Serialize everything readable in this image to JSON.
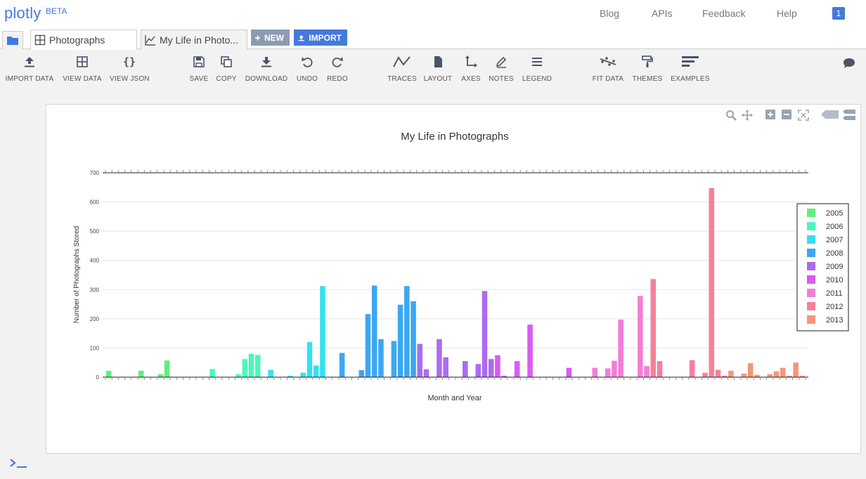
{
  "app": {
    "logo": "plotly",
    "beta": "BETA"
  },
  "topnav": {
    "blog": "Blog",
    "apis": "APIs",
    "feedback": "Feedback",
    "help": "Help",
    "notifications": "1"
  },
  "tabs": {
    "folder_icon": "folder-icon",
    "items": [
      {
        "label": "Photographs",
        "icon": "grid-icon"
      },
      {
        "label": "My Life in Photo...",
        "icon": "line-chart-icon"
      }
    ],
    "new_label": "NEW",
    "import_label": "IMPORT"
  },
  "toolbar": {
    "import_data": "IMPORT DATA",
    "view_data": "VIEW DATA",
    "view_json": "VIEW JSON",
    "save": "SAVE",
    "copy": "COPY",
    "download": "DOWNLOAD",
    "undo": "UNDO",
    "redo": "REDO",
    "traces": "TRACES",
    "layout": "LAYOUT",
    "axes": "AXES",
    "notes": "NOTES",
    "legend": "LEGEND",
    "fit_data": "FIT DATA",
    "themes": "THEMES",
    "examples": "EXAMPLES"
  },
  "colors": {
    "accent": "#447adb",
    "new_button": "#8c9bb3",
    "icon": "#4a5568"
  },
  "chart_data": {
    "type": "bar",
    "title": "My Life in Photographs",
    "xlabel": "Month and Year",
    "ylabel": "Number of Photographs Stored",
    "ylim": [
      0,
      700
    ],
    "yticks": [
      0,
      100,
      200,
      300,
      400,
      500,
      600,
      700
    ],
    "grid": true,
    "legend_position": "right",
    "slots_per_year": 12,
    "series": [
      {
        "name": "2005",
        "color": "#5ef07c",
        "values": [
          22,
          0,
          0,
          0,
          0,
          22,
          0,
          0,
          10,
          57,
          0,
          0
        ]
      },
      {
        "name": "2006",
        "color": "#4ff5bd",
        "values": [
          0,
          0,
          0,
          0,
          28,
          0,
          0,
          0,
          10,
          62,
          80,
          76
        ]
      },
      {
        "name": "2007",
        "color": "#36dff2",
        "values": [
          0,
          25,
          0,
          0,
          5,
          0,
          15,
          120,
          40,
          312,
          0,
          0
        ]
      },
      {
        "name": "2008",
        "color": "#3ca7f2",
        "values": [
          83,
          0,
          0,
          24,
          216,
          314,
          130,
          0,
          124,
          248,
          312,
          260
        ]
      },
      {
        "name": "2009",
        "color": "#ab6cf0",
        "values": [
          114,
          27,
          0,
          130,
          68,
          0,
          0,
          55,
          0,
          45,
          295,
          62
        ]
      },
      {
        "name": "2010",
        "color": "#d95cf2",
        "values": [
          75,
          5,
          0,
          55,
          0,
          180,
          0,
          0,
          0,
          0,
          0,
          32
        ]
      },
      {
        "name": "2011",
        "color": "#f27ed8",
        "values": [
          0,
          0,
          0,
          32,
          0,
          30,
          56,
          197,
          0,
          0,
          278,
          38
        ]
      },
      {
        "name": "2012",
        "color": "#f5809a",
        "values": [
          336,
          55,
          0,
          0,
          0,
          0,
          58,
          0,
          15,
          648,
          25,
          5
        ]
      },
      {
        "name": "2013",
        "color": "#f5957a",
        "values": [
          22,
          0,
          12,
          48,
          8,
          0,
          10,
          20,
          32,
          5,
          50,
          5
        ]
      }
    ]
  }
}
